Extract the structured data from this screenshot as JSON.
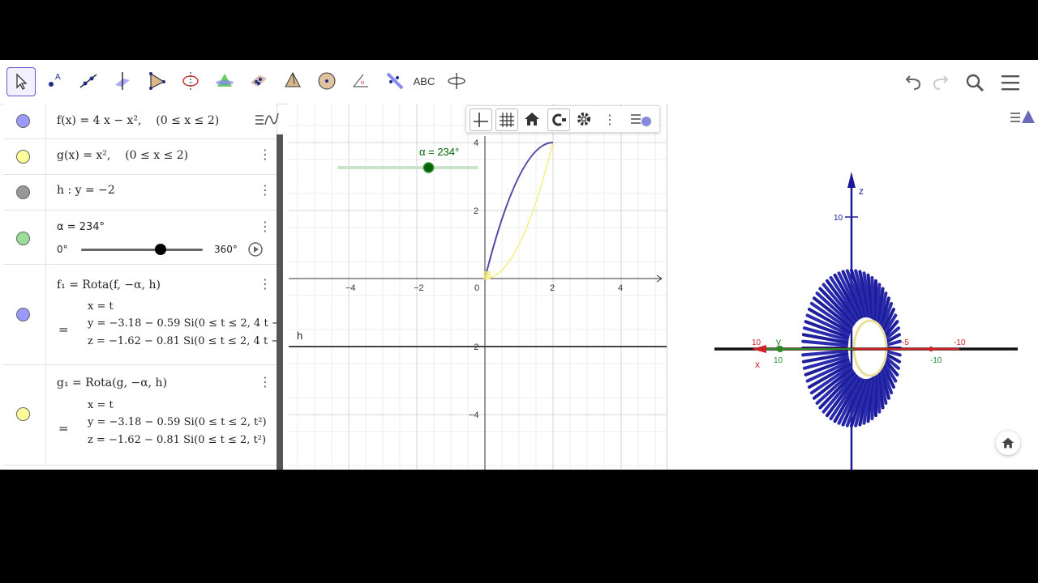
{
  "toolbar": {
    "tools": [
      "move-tool-icon",
      "point-tool-icon",
      "line-tool-icon",
      "perpendicular-tool-icon",
      "polygon-tool-icon",
      "circle-axis-tool-icon",
      "intersect-surfaces-tool-icon",
      "plane-tool-icon",
      "pyramid-tool-icon",
      "sphere-tool-icon",
      "angle-tool-icon",
      "reflect-tool-icon",
      "text-tool-icon",
      "rotate-view-tool-icon"
    ],
    "text_tool_label": "ABC",
    "right": [
      "undo-icon",
      "redo-icon",
      "search-icon",
      "hamburger-menu-icon"
    ]
  },
  "algebra": {
    "f": {
      "expr": "f(x)  =  4 x − x², ",
      "domain": "(0 ≤ x ≤ 2)",
      "color": "#9999ff"
    },
    "g": {
      "expr": "g(x)  =  x², ",
      "domain": "(0 ≤ x ≤ 2)",
      "color": "#ffff99"
    },
    "h": {
      "expr": "h :  y  =  −2",
      "color": "#999999"
    },
    "alpha": {
      "expr": "α = 234°",
      "min_label": "0°",
      "max_label": "360°",
      "value": 234,
      "min": 0,
      "max": 360,
      "color": "#99dd99"
    },
    "f1": {
      "def": "f₁  =  Rota(f, −α, h)",
      "eq": "=",
      "x": "x = t",
      "y": "y = −3.18 − 0.59 Si(0 ≤ t ≤ 2, 4 t −",
      "z": "z = −1.62 − 0.81 Si(0 ≤ t ≤ 2, 4 t −",
      "color": "#9999ff"
    },
    "g1": {
      "def": "g₁  =  Rota(g, −α, h)",
      "eq": "=",
      "x": "x = t",
      "y": "y = −3.18 − 0.59 Si(0 ≤ t ≤ 2, t²)",
      "z": "z = −1.62 − 0.81 Si(0 ≤ t ≤ 2, t²)",
      "color": "#ffff99"
    }
  },
  "graphics2d": {
    "slider_label": "α = 234°",
    "line_label": "h",
    "x_ticks": [
      "−4",
      "−2",
      "0",
      "2",
      "4"
    ],
    "y_ticks": [
      "4",
      "2",
      "−2",
      "−4"
    ]
  },
  "graphics3d": {
    "z_label": "z",
    "z_tick": "10",
    "x_label": "x",
    "y_label": "y",
    "tick_labels": [
      "10",
      "-5",
      "-10",
      "-10",
      "10"
    ]
  }
}
